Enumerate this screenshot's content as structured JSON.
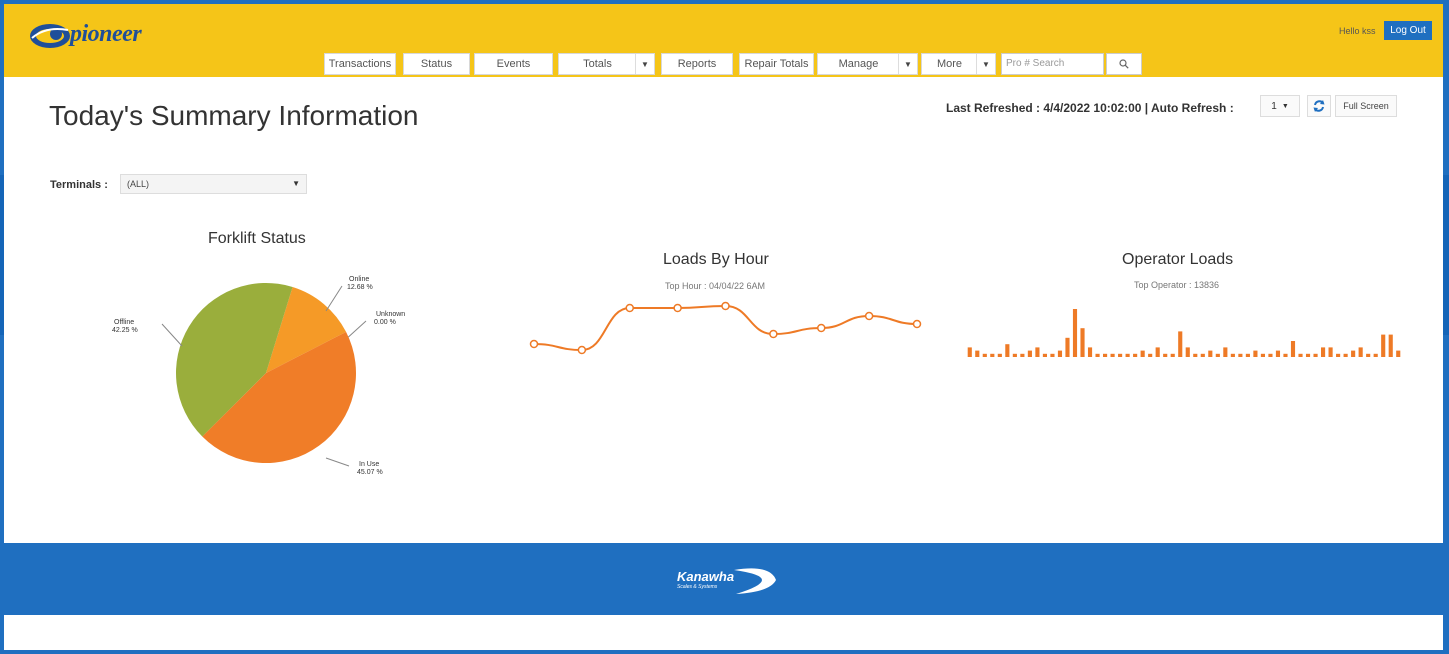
{
  "header": {
    "logo_text": "pioneer",
    "nav": [
      {
        "label": "Transactions",
        "dropdown": false
      },
      {
        "label": "Status",
        "dropdown": false
      },
      {
        "label": "Events",
        "dropdown": false
      },
      {
        "label": "Totals",
        "dropdown": true
      },
      {
        "label": "Reports",
        "dropdown": false
      },
      {
        "label": "Repair Totals",
        "dropdown": false
      },
      {
        "label": "Manage",
        "dropdown": true
      },
      {
        "label": "More",
        "dropdown": true
      }
    ],
    "search_placeholder": "Pro # Search",
    "search_icon": "search-icon",
    "greeting": "Hello kss",
    "logout_label": "Log Out"
  },
  "main": {
    "title": "Today's Summary Information",
    "refresh": {
      "text": "Last Refreshed : 4/4/2022 10:02:00 | Auto Refresh :",
      "interval": "1",
      "full_screen_label": "Full Screen"
    },
    "terminals": {
      "label": "Terminals :",
      "value": "(ALL)"
    }
  },
  "colors": {
    "topbar": "#f5c518",
    "footer": "#1f6fc0",
    "accent": "#ee7a26",
    "offline": "#9aae3c",
    "online": "#f59a27",
    "in_use": "#f07d28"
  },
  "footer": {
    "logo_text": "Kanawha",
    "logo_sub": "Scales & Systems"
  },
  "chart_data": [
    {
      "type": "pie",
      "title": "Forklift Status",
      "slices": [
        {
          "label": "Online",
          "pct_label": "12.68 %",
          "value": 12.68
        },
        {
          "label": "Unknown",
          "pct_label": "0.00 %",
          "value": 0.0
        },
        {
          "label": "In Use",
          "pct_label": "45.07 %",
          "value": 45.07
        },
        {
          "label": "Offline",
          "pct_label": "42.25 %",
          "value": 42.25
        }
      ]
    },
    {
      "type": "line",
      "title": "Loads By Hour",
      "subtitle": "Top Hour : 04/04/22 6AM",
      "values": [
        5,
        2,
        23,
        23,
        24,
        10,
        13,
        19,
        15
      ]
    },
    {
      "type": "bar",
      "title": "Operator Loads",
      "subtitle": "Top Operator : 13836",
      "values": [
        3,
        2,
        1,
        1,
        1,
        4,
        1,
        1,
        2,
        3,
        1,
        1,
        2,
        6,
        15,
        9,
        3,
        1,
        1,
        1,
        1,
        1,
        1,
        2,
        1,
        3,
        1,
        1,
        8,
        3,
        1,
        1,
        2,
        1,
        3,
        1,
        1,
        1,
        2,
        1,
        1,
        2,
        1,
        5,
        1,
        1,
        1,
        3,
        3,
        1,
        1,
        2,
        3,
        1,
        1,
        7,
        7,
        2
      ]
    }
  ]
}
